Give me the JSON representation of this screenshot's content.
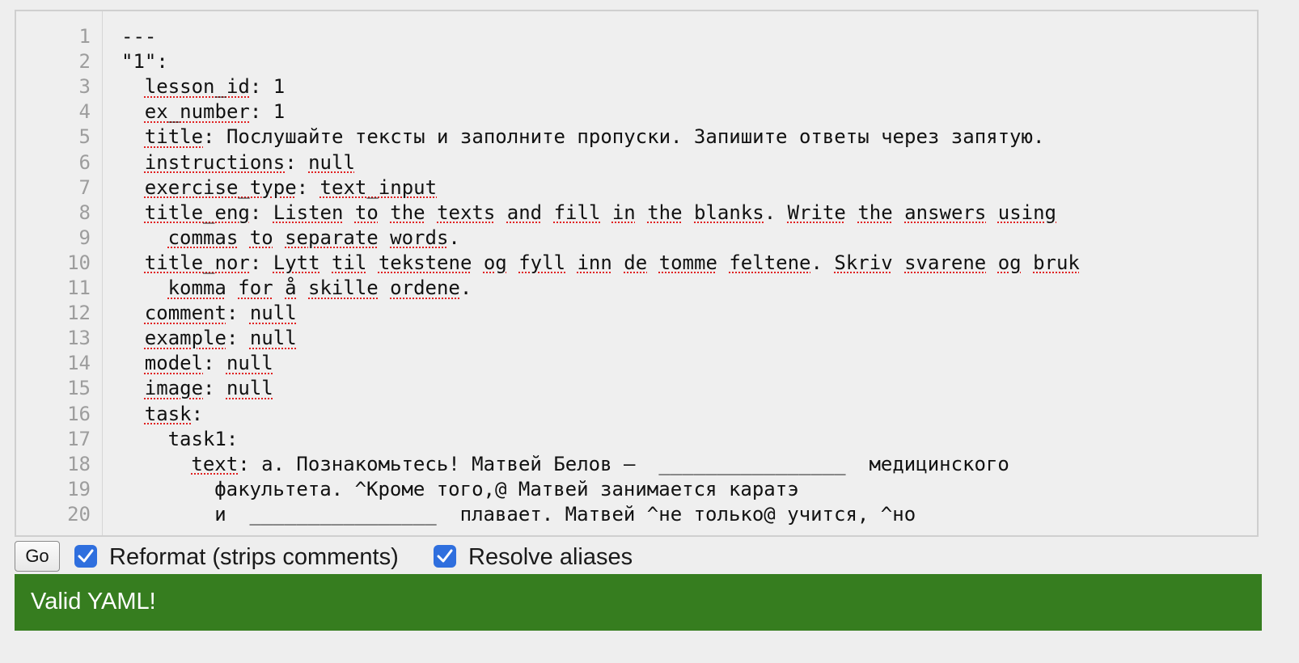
{
  "editor": {
    "lines": [
      {
        "n": "1",
        "ind": 0,
        "segs": [
          [
            "---",
            false
          ]
        ]
      },
      {
        "n": "2",
        "ind": 0,
        "segs": [
          [
            "\"1\":",
            false
          ]
        ]
      },
      {
        "n": "3",
        "ind": 2,
        "segs": [
          [
            "lesson_id",
            true
          ],
          [
            ": 1",
            false
          ]
        ]
      },
      {
        "n": "4",
        "ind": 2,
        "segs": [
          [
            "ex_number",
            true
          ],
          [
            ": 1",
            false
          ]
        ]
      },
      {
        "n": "5",
        "ind": 2,
        "segs": [
          [
            "title",
            true
          ],
          [
            ": Послушайте тексты и заполните пропуски. Запишите ответы через запятую.",
            false
          ]
        ]
      },
      {
        "n": "6",
        "ind": 2,
        "segs": [
          [
            "instructions",
            true
          ],
          [
            ": ",
            false
          ],
          [
            "null",
            true
          ]
        ]
      },
      {
        "n": "7",
        "ind": 2,
        "segs": [
          [
            "exercise_type",
            true
          ],
          [
            ": ",
            false
          ],
          [
            "text_input",
            true
          ]
        ]
      },
      {
        "n": "8",
        "ind": 2,
        "segs": [
          [
            "title_eng",
            true
          ],
          [
            ": ",
            false
          ],
          [
            "Listen",
            true
          ],
          [
            " ",
            false
          ],
          [
            "to",
            true
          ],
          [
            " ",
            false
          ],
          [
            "the",
            true
          ],
          [
            " ",
            false
          ],
          [
            "texts",
            true
          ],
          [
            " ",
            false
          ],
          [
            "and",
            true
          ],
          [
            " ",
            false
          ],
          [
            "fill",
            true
          ],
          [
            " ",
            false
          ],
          [
            "in",
            true
          ],
          [
            " ",
            false
          ],
          [
            "the",
            true
          ],
          [
            " ",
            false
          ],
          [
            "blanks",
            true
          ],
          [
            ". ",
            false
          ],
          [
            "Write",
            true
          ],
          [
            " ",
            false
          ],
          [
            "the",
            true
          ],
          [
            " ",
            false
          ],
          [
            "answers",
            true
          ],
          [
            " ",
            false
          ],
          [
            "using",
            true
          ]
        ]
      },
      {
        "n": "9",
        "ind": 4,
        "segs": [
          [
            "commas",
            true
          ],
          [
            " ",
            false
          ],
          [
            "to",
            true
          ],
          [
            " ",
            false
          ],
          [
            "separate",
            true
          ],
          [
            " ",
            false
          ],
          [
            "words",
            true
          ],
          [
            ".",
            false
          ]
        ]
      },
      {
        "n": "10",
        "ind": 2,
        "segs": [
          [
            "title_nor",
            true
          ],
          [
            ": ",
            false
          ],
          [
            "Lytt",
            true
          ],
          [
            " ",
            false
          ],
          [
            "til",
            true
          ],
          [
            " ",
            false
          ],
          [
            "tekstene",
            true
          ],
          [
            " ",
            false
          ],
          [
            "og",
            true
          ],
          [
            " ",
            false
          ],
          [
            "fyll",
            true
          ],
          [
            " ",
            false
          ],
          [
            "inn",
            true
          ],
          [
            " ",
            false
          ],
          [
            "de",
            true
          ],
          [
            " ",
            false
          ],
          [
            "tomme",
            true
          ],
          [
            " ",
            false
          ],
          [
            "feltene",
            true
          ],
          [
            ". ",
            false
          ],
          [
            "Skriv",
            true
          ],
          [
            " ",
            false
          ],
          [
            "svarene",
            true
          ],
          [
            " ",
            false
          ],
          [
            "og",
            true
          ],
          [
            " ",
            false
          ],
          [
            "bruk",
            true
          ]
        ]
      },
      {
        "n": "11",
        "ind": 4,
        "segs": [
          [
            "komma",
            true
          ],
          [
            " ",
            false
          ],
          [
            "for",
            true
          ],
          [
            " ",
            false
          ],
          [
            "å",
            true
          ],
          [
            " ",
            false
          ],
          [
            "skille",
            true
          ],
          [
            " ",
            false
          ],
          [
            "ordene",
            true
          ],
          [
            ".",
            false
          ]
        ]
      },
      {
        "n": "12",
        "ind": 2,
        "segs": [
          [
            "comment",
            true
          ],
          [
            ": ",
            false
          ],
          [
            "null",
            true
          ]
        ]
      },
      {
        "n": "13",
        "ind": 2,
        "segs": [
          [
            "example",
            true
          ],
          [
            ": ",
            false
          ],
          [
            "null",
            true
          ]
        ]
      },
      {
        "n": "14",
        "ind": 2,
        "segs": [
          [
            "model",
            true
          ],
          [
            ": ",
            false
          ],
          [
            "null",
            true
          ]
        ]
      },
      {
        "n": "15",
        "ind": 2,
        "segs": [
          [
            "image",
            true
          ],
          [
            ": ",
            false
          ],
          [
            "null",
            true
          ]
        ]
      },
      {
        "n": "16",
        "ind": 2,
        "segs": [
          [
            "task",
            true
          ],
          [
            ":",
            false
          ]
        ]
      },
      {
        "n": "17",
        "ind": 4,
        "segs": [
          [
            "task1:",
            false
          ]
        ]
      },
      {
        "n": "18",
        "ind": 6,
        "segs": [
          [
            "text",
            true
          ],
          [
            ": a. Познакомьтесь! Матвей Белов —  ________________  медицинского",
            false
          ]
        ]
      },
      {
        "n": "19",
        "ind": 8,
        "segs": [
          [
            "факультета. ^Кроме того,@ Матвей занимается каратэ",
            false
          ]
        ]
      },
      {
        "n": "20",
        "ind": 8,
        "segs": [
          [
            "и  ________________  плавает. Матвей ^не только@ учится, ^но",
            false
          ]
        ]
      }
    ]
  },
  "controls": {
    "go_label": "Go",
    "reformat_label": "Reformat (strips comments)",
    "reformat_checked": true,
    "resolve_label": "Resolve aliases",
    "resolve_checked": true
  },
  "status": {
    "text": "Valid YAML!",
    "color": "#367d1f"
  }
}
